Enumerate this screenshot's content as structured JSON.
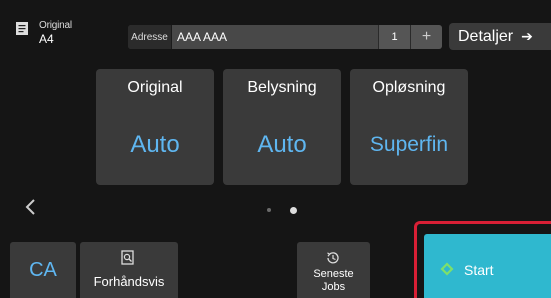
{
  "header": {
    "original_label": "Original",
    "original_size": "A4",
    "address_label": "Adresse",
    "address_value": "AAA AAA",
    "address_count": "1",
    "address_add": "+",
    "details_label": "Detaljer"
  },
  "settings": [
    {
      "title": "Original",
      "value": "Auto"
    },
    {
      "title": "Belysning",
      "value": "Auto"
    },
    {
      "title": "Opløsning",
      "value": "Superfin"
    }
  ],
  "pager": {
    "current_page": 2,
    "total_pages": 2
  },
  "bottom": {
    "ca_label": "CA",
    "preview_label": "Forhåndsvis",
    "recent_label_line1": "Seneste",
    "recent_label_line2": "Jobs",
    "start_label": "Start"
  },
  "colors": {
    "accent_value": "#5fb6f0",
    "start_button": "#2fb8cf",
    "highlight": "#d81f35",
    "panel": "#3a3a3a",
    "background": "#151515"
  },
  "icons": {
    "original": "document-icon",
    "details": "arrow-right-icon",
    "prev": "chevron-left-icon",
    "preview": "preview-magnifier-icon",
    "recent": "history-clock-icon",
    "start": "diamond-start-icon"
  }
}
